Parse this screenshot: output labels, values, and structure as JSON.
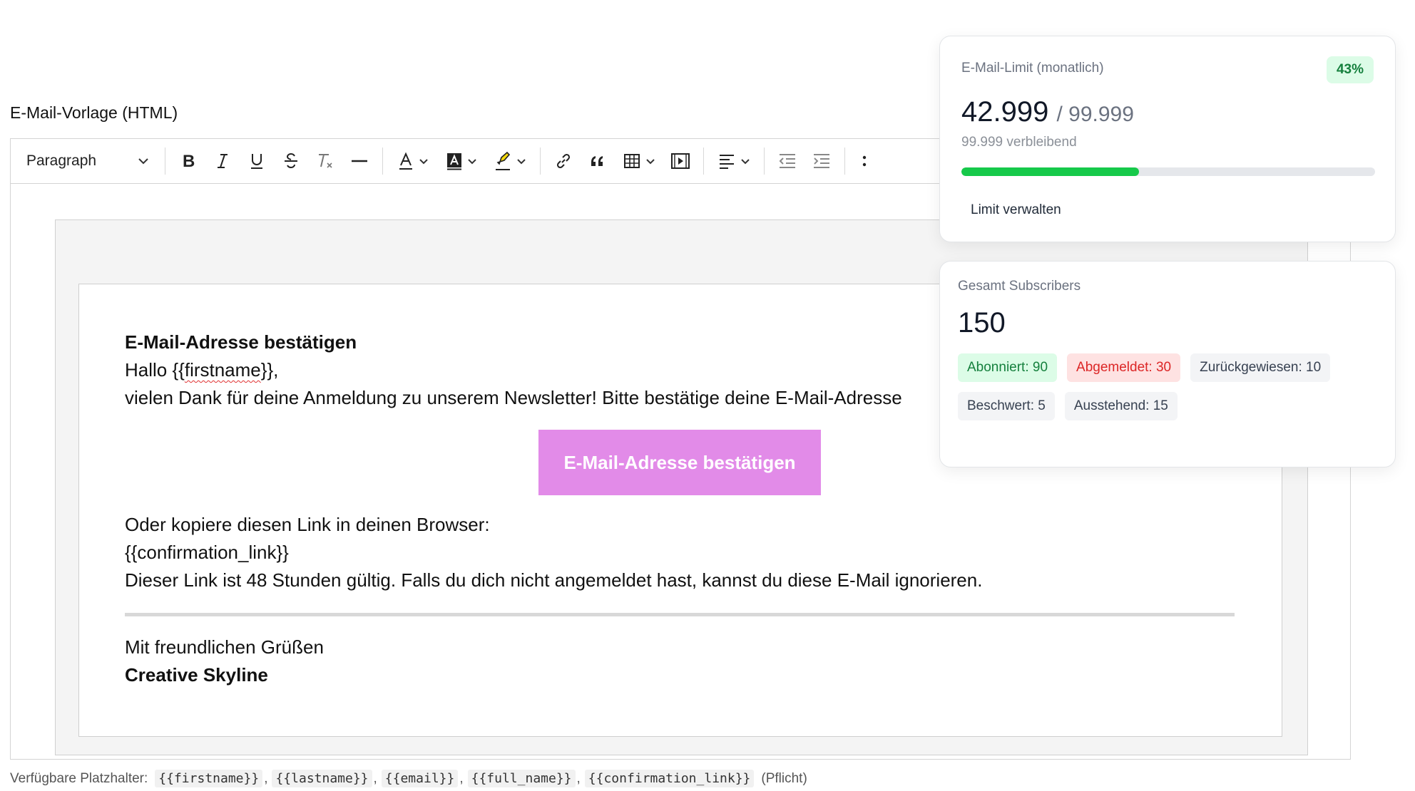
{
  "editor": {
    "label": "E-Mail-Vorlage (HTML)",
    "toolbar": {
      "block_format": "Paragraph",
      "buttons": [
        "bold",
        "italic",
        "underline",
        "strikethrough",
        "clear-formatting",
        "horizontal-line",
        "font-color",
        "background-color",
        "highlight",
        "link",
        "blockquote",
        "table",
        "media",
        "align",
        "outdent",
        "indent",
        "more"
      ]
    }
  },
  "email": {
    "heading": "E-Mail-Adresse bestätigen",
    "greeting_prefix": "Hallo {{",
    "greeting_placeholder": "firstname",
    "greeting_suffix": "}},",
    "thanks": "vielen Dank für deine Anmeldung zu unserem Newsletter! Bitte bestätige deine E-Mail-Adresse",
    "button_label": "E-Mail-Adresse bestätigen",
    "button_color": "#e28be8",
    "copy_text": "Oder kopiere diesen Link in deinen Browser:",
    "confirmation_link": "{{confirmation_link}}",
    "validity": "Dieser Link ist 48 Stunden gültig. Falls du dich nicht angemeldet hast, kannst du diese E-Mail ignorieren.",
    "regards": "Mit freundlichen Grüßen",
    "signature": "Creative Skyline"
  },
  "placeholders": {
    "label": "Verfügbare Platzhalter:",
    "items": [
      "{{firstname}}",
      "{{lastname}}",
      "{{email}}",
      "{{full_name}}",
      "{{confirmation_link}}"
    ],
    "required_note": "(Pflicht)"
  },
  "limit_card": {
    "title": "E-Mail-Limit (monatlich)",
    "percent": "43%",
    "used": "42.999",
    "total": "/ 99.999",
    "remaining": "99.999 verbleibend",
    "progress": 0.43,
    "action": "Limit verwalten",
    "accent": "#16c94a"
  },
  "subs_card": {
    "title": "Gesamt Subscribers",
    "total": "150",
    "chips": [
      {
        "label": "Abonniert: 90",
        "tone": "green"
      },
      {
        "label": "Abgemeldet: 30",
        "tone": "red"
      },
      {
        "label": "Zurückgewiesen: 10",
        "tone": "gray"
      },
      {
        "label": "Beschwert: 5",
        "tone": "gray"
      },
      {
        "label": "Ausstehend: 15",
        "tone": "gray"
      }
    ]
  }
}
